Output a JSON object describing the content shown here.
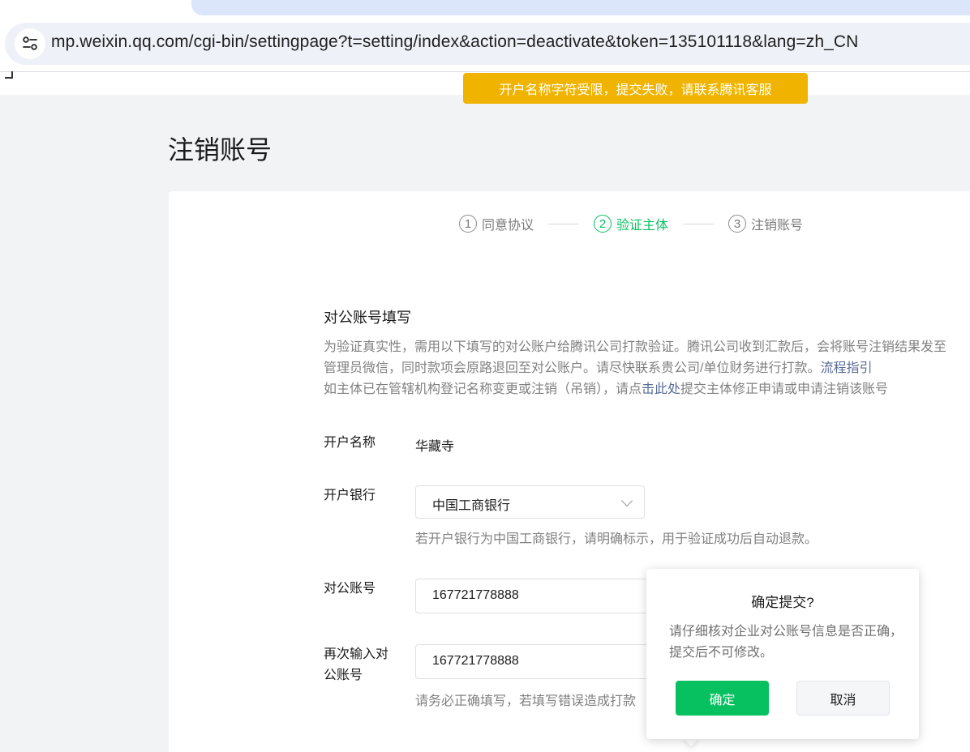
{
  "browser": {
    "url": "mp.weixin.qq.com/cgi-bin/settingpage?t=setting/index&action=deactivate&token=135101118&lang=zh_CN",
    "site_info_icon": "tune-icon"
  },
  "toast": {
    "message": "开户名称字符受限，提交失败，请联系腾讯客服",
    "color": "#f0b400"
  },
  "page": {
    "title": "注销账号"
  },
  "steps": [
    {
      "num": "1",
      "label": "同意协议",
      "active": false
    },
    {
      "num": "2",
      "label": "验证主体",
      "active": true
    },
    {
      "num": "3",
      "label": "注销账号",
      "active": false
    }
  ],
  "section": {
    "title": "对公账号填写",
    "desc_line1": "为验证真实性，需用以下填写的对公账户给腾讯公司打款验证。腾讯公司收到汇款后，会将账号注销结果发至管理员微信，同时款项会原路退回至对公账户。请尽快联系贵公司/单位财务进行打款。",
    "desc_link1": "流程指引",
    "desc_line2_pre": "如主体已在管辖机构登记名称变更或注销（吊销），请点",
    "desc_link2": "击此处",
    "desc_line2_post": "提交主体修正申请或申请注销该账号"
  },
  "form": {
    "account_name_label": "开户名称",
    "account_name_value": "华藏寺",
    "bank_label": "开户银行",
    "bank_value": "中国工商银行",
    "bank_hint": "若开户银行为中国工商银行，请明确标示，用于验证成功后自动退款。",
    "account_no_label": "对公账号",
    "account_no_value": "167721778888",
    "confirm_label_line1": "再次输入对",
    "confirm_label_line2": "公账号",
    "confirm_value": "167721778888",
    "confirm_hint": "请务必正确填写，若填写错误造成打款"
  },
  "popover": {
    "title": "确定提交?",
    "body": "请仔细核对企业对公账号信息是否正确，提交后不可修改。",
    "ok_label": "确定",
    "cancel_label": "取消",
    "ok_color": "#07c160"
  },
  "colors": {
    "accent": "#07c160",
    "link": "#576b95",
    "warning": "#f0b400"
  }
}
